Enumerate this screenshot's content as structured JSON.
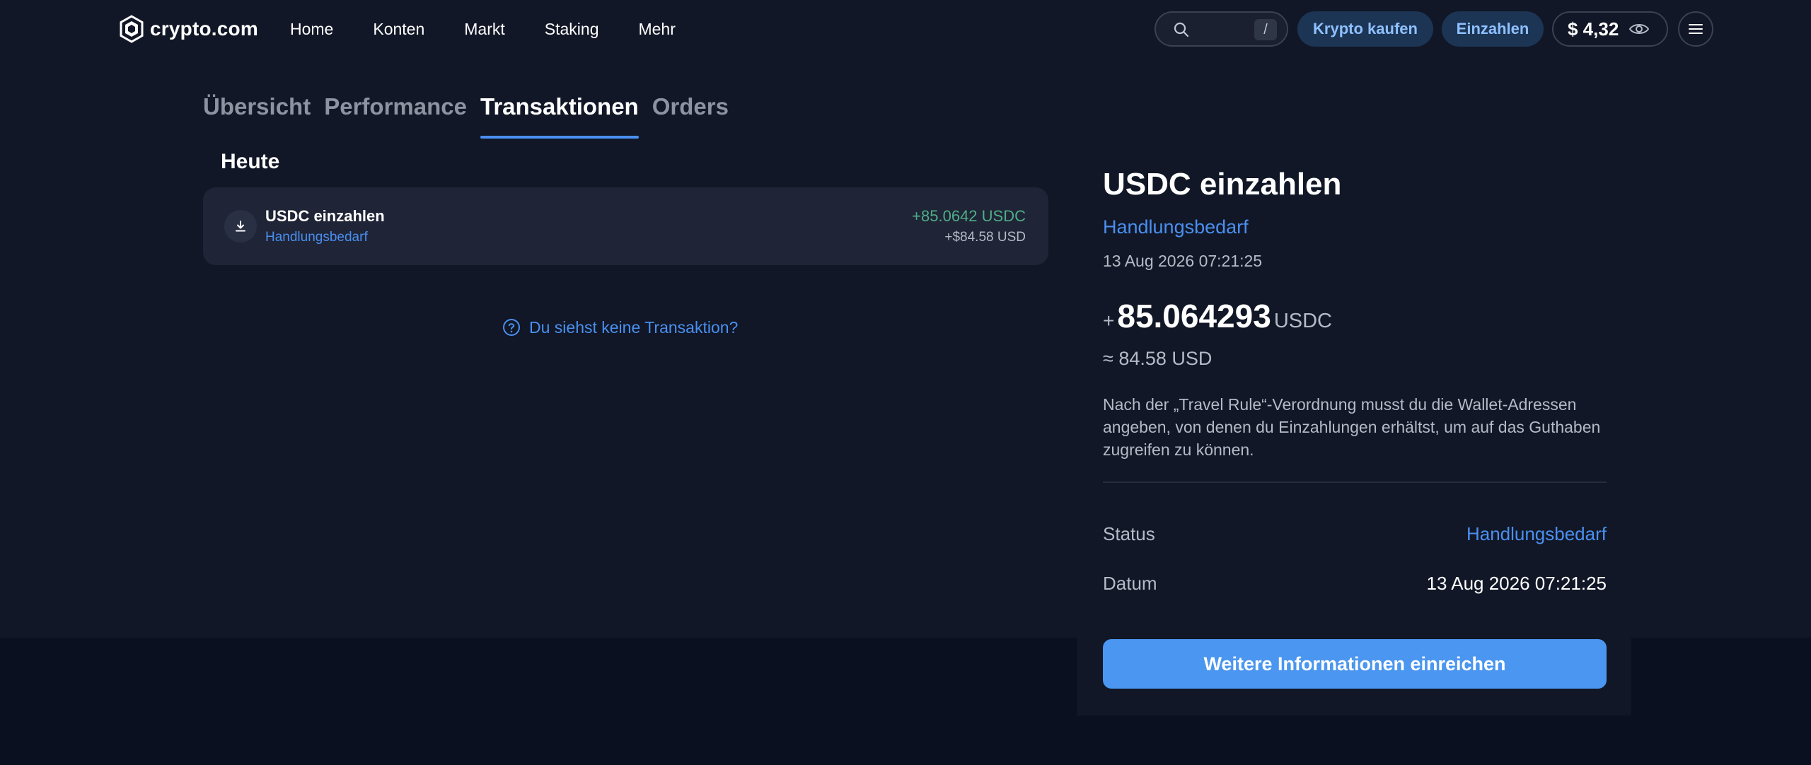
{
  "header": {
    "logo_text": "crypto.com",
    "nav": [
      "Home",
      "Konten",
      "Markt",
      "Staking",
      "Mehr"
    ],
    "search_shortcut": "/",
    "buy_label": "Krypto kaufen",
    "deposit_label": "Einzahlen",
    "balance": "$ 4,32"
  },
  "tabs": [
    {
      "label": "Übersicht",
      "active": false
    },
    {
      "label": "Performance",
      "active": false
    },
    {
      "label": "Transaktionen",
      "active": true
    },
    {
      "label": "Orders",
      "active": false
    }
  ],
  "transactions": {
    "group_title": "Heute",
    "items": [
      {
        "title": "USDC einzahlen",
        "status": "Handlungsbedarf",
        "amount": "+85.0642 USDC",
        "usd": "+$84.58 USD"
      }
    ],
    "help_link": "Du siehst keine Transaktion?"
  },
  "detail": {
    "title": "USDC einzahlen",
    "status": "Handlungsbedarf",
    "date": "13 Aug 2026 07:21:25",
    "amount_sign": "+",
    "amount_value": "85.064293",
    "amount_unit": "USDC",
    "approx": "≈ 84.58 USD",
    "note": "Nach der „Travel Rule“-Verordnung musst du die Wallet-Adressen angeben, von denen du Einzahlungen erhältst, um auf das Guthaben zugreifen zu können.",
    "rows": {
      "status_label": "Status",
      "status_value": "Handlungsbedarf",
      "date_label": "Datum",
      "date_value": "13 Aug 2026 07:21:25"
    },
    "cta": "Weitere Informationen einreichen"
  },
  "colors": {
    "accent": "#4a8ff0",
    "positive": "#4fae87",
    "page_bg": "#111726",
    "card_bg": "#1f2436"
  },
  "icons": [
    "crypto-logo-icon",
    "search-icon",
    "eye-icon",
    "menu-icon",
    "download-icon",
    "question-circle-icon"
  ]
}
